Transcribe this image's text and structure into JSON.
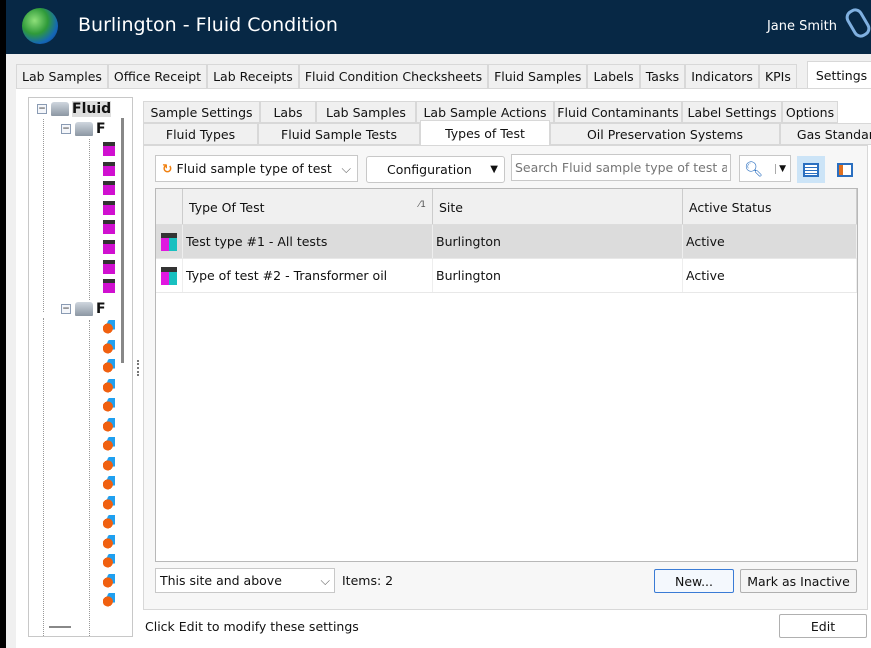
{
  "app": {
    "title": "Burlington - Fluid Condition",
    "user": "Jane Smith"
  },
  "main_tabs": [
    "Lab Samples",
    "Office Receipt",
    "Lab Receipts",
    "Fluid Condition Checksheets",
    "Fluid Samples",
    "Labels",
    "Tasks",
    "Indicators",
    "KPIs",
    "Settings"
  ],
  "tree": {
    "root": "Fluid",
    "child1": "F",
    "child2": "F"
  },
  "sub_tabs_row1": [
    "Sample Settings",
    "Labs",
    "Lab Samples",
    "Lab Sample Actions",
    "Fluid Contaminants",
    "Label Settings",
    "Options"
  ],
  "sub_tabs_row2": [
    "Fluid Types",
    "Fluid Sample Tests",
    "Types of Test",
    "Oil Preservation Systems",
    "Gas Standards"
  ],
  "toolbar": {
    "entity_select": "Fluid sample type of test",
    "configuration": "Configuration",
    "search_placeholder": "Search Fluid sample type of test at s"
  },
  "grid": {
    "columns": [
      "Type Of Test",
      "Site",
      "Active Status"
    ],
    "sort_indicator": "1",
    "rows": [
      [
        "Test type #1 - All tests",
        "Burlington",
        "Active"
      ],
      [
        "Type of test #2 - Transformer oil",
        "Burlington",
        "Active"
      ]
    ]
  },
  "footer": {
    "scope_select": "This site and above",
    "items_count": "Items: 2",
    "new_button": "New...",
    "inactive_button": "Mark as Inactive"
  },
  "status": {
    "message": "Click Edit to modify these settings",
    "edit_button": "Edit"
  }
}
